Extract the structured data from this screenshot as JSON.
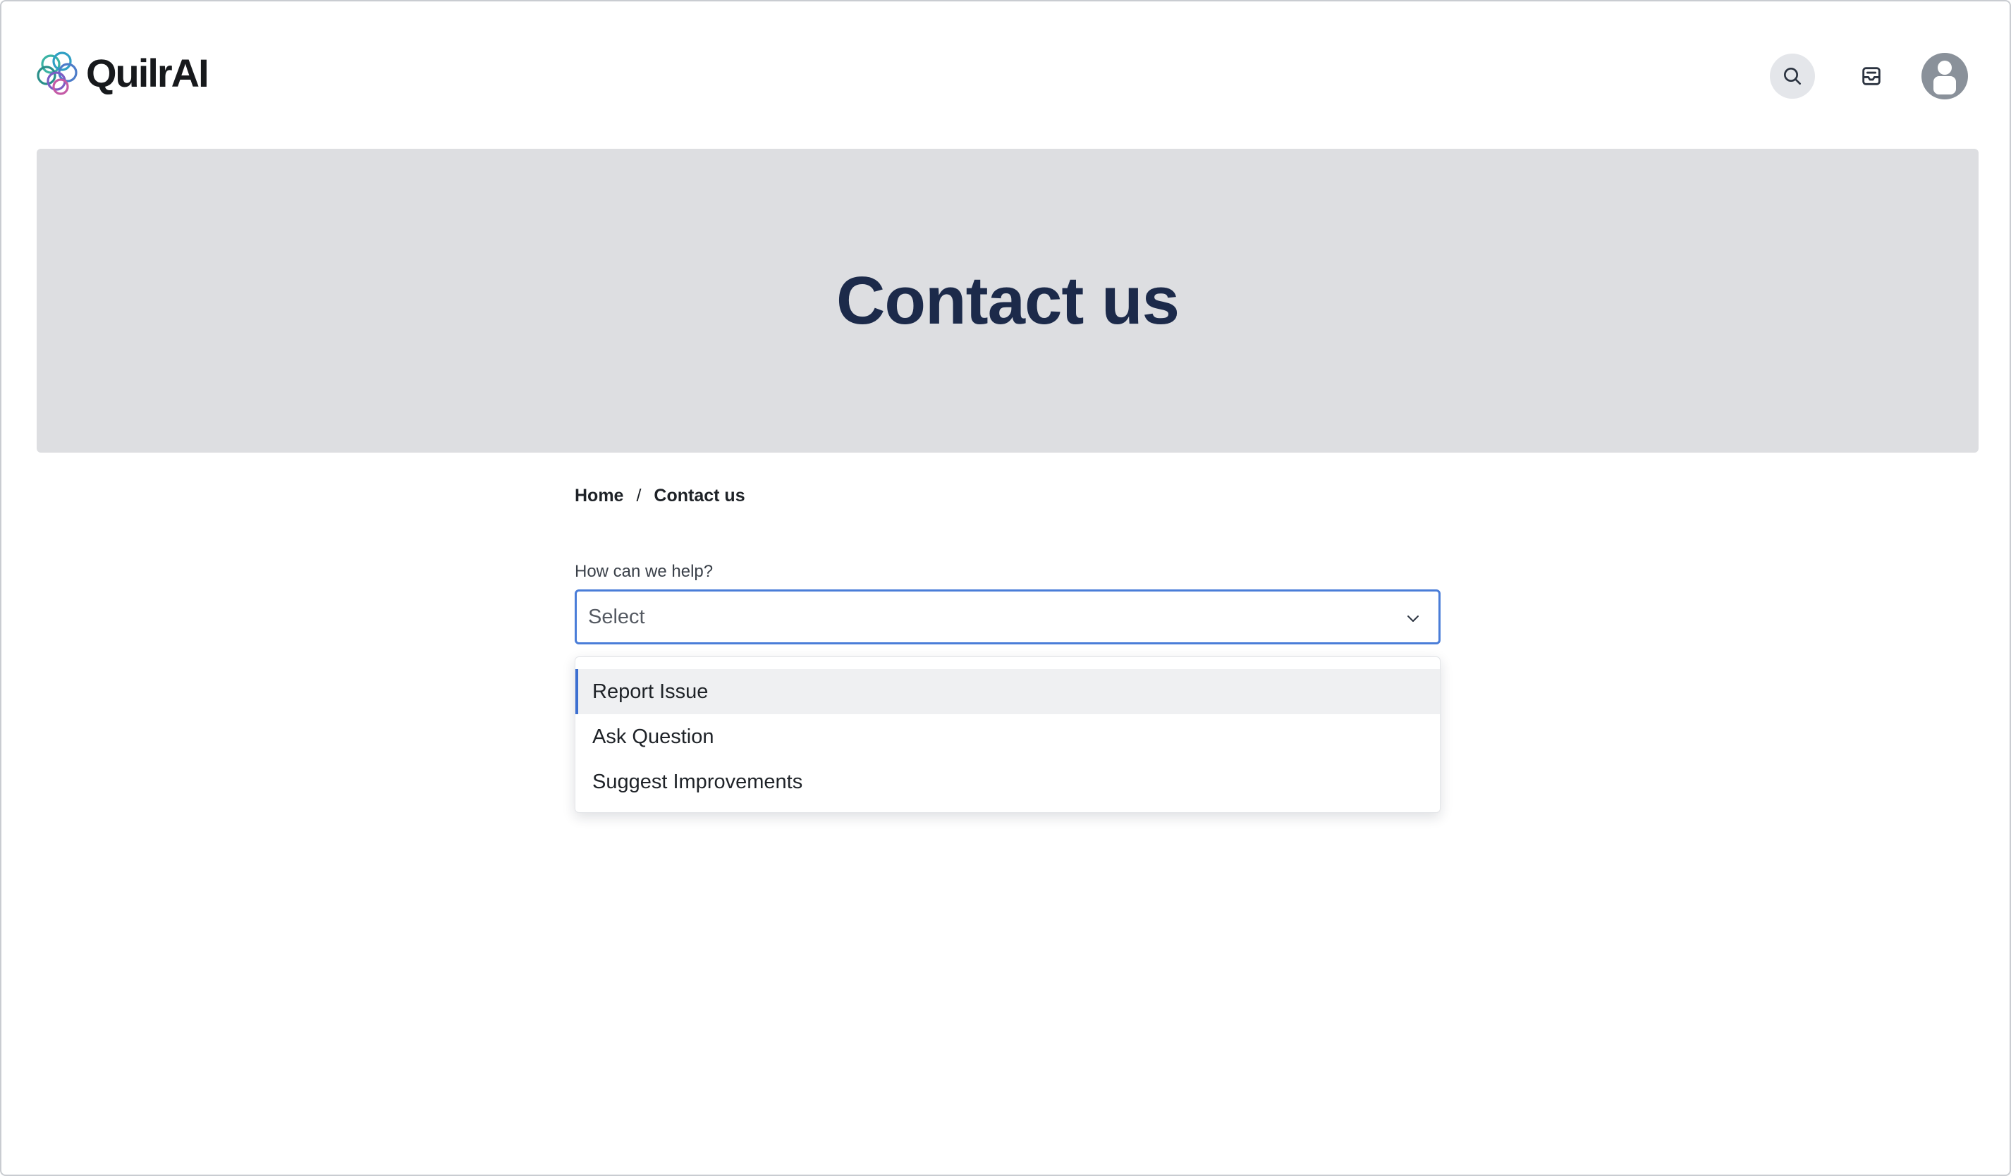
{
  "app": {
    "brand_name": "QuilrAI"
  },
  "header": {
    "search_icon": "search-icon",
    "inbox_icon": "inbox-icon",
    "avatar_icon": "user-avatar-icon"
  },
  "hero": {
    "title": "Contact us"
  },
  "breadcrumb": {
    "items": [
      {
        "label": "Home"
      },
      {
        "label": "Contact us"
      }
    ],
    "separator": "/"
  },
  "form": {
    "help_label": "How can we help?",
    "select_value": "Select",
    "options": [
      {
        "label": "Report Issue",
        "highlighted": true
      },
      {
        "label": "Ask Question",
        "highlighted": false
      },
      {
        "label": "Suggest Improvements",
        "highlighted": false
      }
    ]
  },
  "colors": {
    "accent": "#4a7dd8",
    "hero_bg": "#dddee1",
    "title": "#1c2a4a"
  }
}
